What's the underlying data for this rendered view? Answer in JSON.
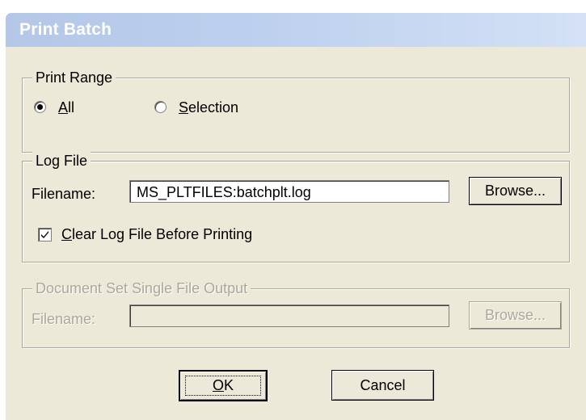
{
  "window": {
    "title": "Print Batch"
  },
  "print_range": {
    "legend": "Print Range",
    "options": [
      {
        "label_accel": "A",
        "label_rest": "ll",
        "selected": true
      },
      {
        "label_accel": "S",
        "label_rest": "election",
        "selected": false
      }
    ]
  },
  "log_file": {
    "legend": "Log File",
    "filename_label": "Filename:",
    "filename_value": "MS_PLTFILES:batchplt.log",
    "browse_label": "Browse...",
    "clear_checkbox": {
      "label_accel": "C",
      "label_rest": "lear Log File Before Printing",
      "checked": true
    }
  },
  "document_set": {
    "legend": "Document Set Single File Output",
    "enabled": false,
    "filename_label": "Filename:",
    "filename_value": "",
    "browse_label": "Browse..."
  },
  "buttons": {
    "ok_accel": "O",
    "ok_rest": "K",
    "cancel": "Cancel"
  }
}
